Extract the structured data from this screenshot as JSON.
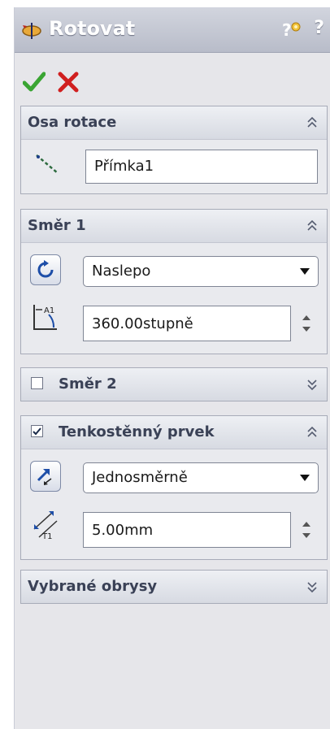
{
  "panel": {
    "title": "Rotovat",
    "help_label": "?"
  },
  "icons": {
    "title": "revolve-feature-icon",
    "help": "help-icon",
    "ok": "checkmark-icon",
    "cancel": "close-icon"
  },
  "groups": {
    "axis": {
      "title": "Osa rotace",
      "value": "Přímka1"
    },
    "direction1": {
      "title": "Směr 1",
      "type": "Naslepo",
      "angle": "360.00stupně"
    },
    "direction2": {
      "title": "Směr 2",
      "checked": false
    },
    "thin": {
      "title": "Tenkostěnný prvek",
      "checked": true,
      "type": "Jednosměrně",
      "thickness": "5.00mm",
      "thickness_label": "T1",
      "angle_label": "A1"
    },
    "contours": {
      "title": "Vybrané obrysy"
    }
  },
  "colors": {
    "ok": "#3aa533",
    "cancel": "#d01f1f",
    "title_text": "#ffffff",
    "group_title": "#3a4156"
  }
}
